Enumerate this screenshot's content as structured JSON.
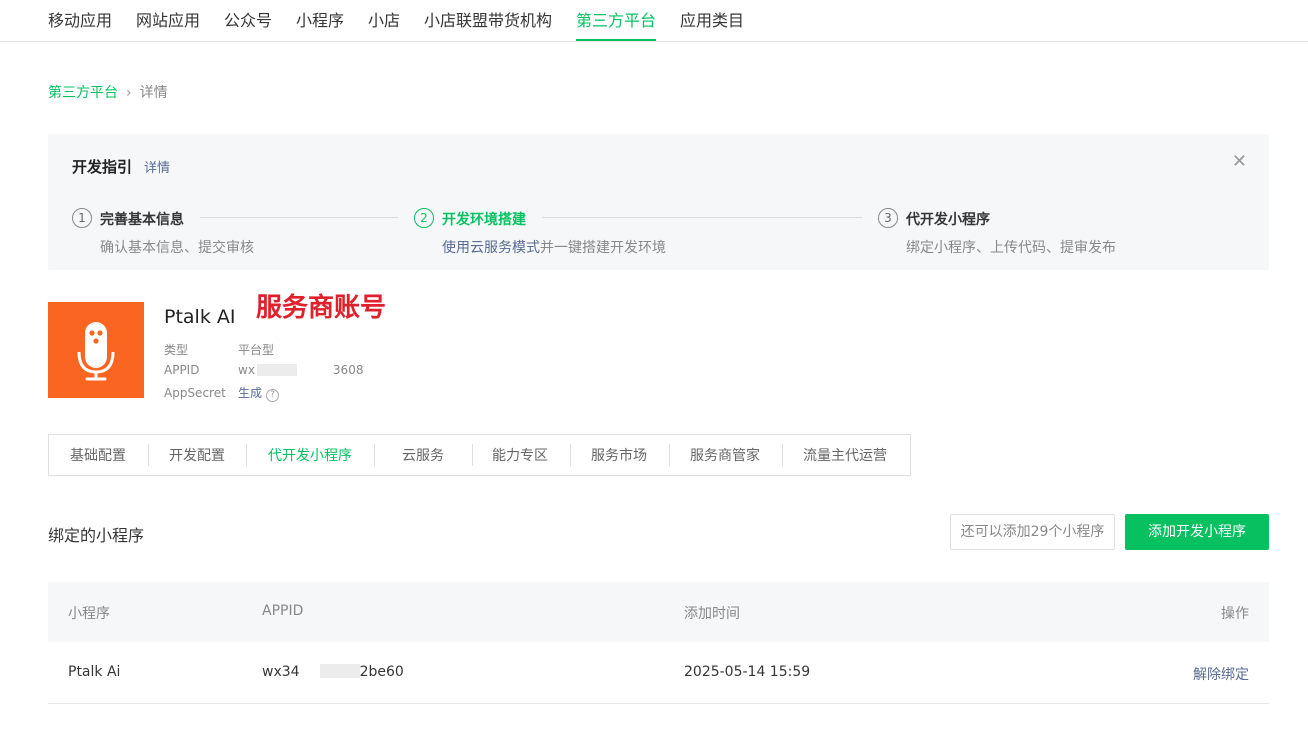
{
  "nav": {
    "items": [
      "移动应用",
      "网站应用",
      "公众号",
      "小程序",
      "小店",
      "小店联盟带货机构",
      "第三方平台",
      "应用类目"
    ],
    "active_index": 6
  },
  "breadcrumb": {
    "parent": "第三方平台",
    "separator": "›",
    "current": "详情"
  },
  "guide": {
    "title": "开发指引",
    "detail_link": "详情",
    "close": "✕",
    "steps": [
      {
        "num": "1",
        "label": "完善基本信息",
        "desc": "确认基本信息、提交审核"
      },
      {
        "num": "2",
        "label": "开发环境搭建",
        "desc_highlight": "使用云服务模式",
        "desc_rest": "并一键搭建开发环境"
      },
      {
        "num": "3",
        "label": "代开发小程序",
        "desc": "绑定小程序、上传代码、提审发布"
      }
    ]
  },
  "account": {
    "name": "Ptalk AI",
    "annotation": "服务商账号",
    "type_label": "类型",
    "type_value": "平台型",
    "appid_label": "APPID",
    "appid_prefix": "wx",
    "appid_suffix": "3608",
    "secret_label": "AppSecret",
    "secret_action": "生成",
    "help": "?"
  },
  "tabs": {
    "items": [
      "基础配置",
      "开发配置",
      "代开发小程序",
      "云服务",
      "能力专区",
      "服务市场",
      "服务商管家",
      "流量主代运营"
    ],
    "active_index": 2
  },
  "bound": {
    "title": "绑定的小程序",
    "quota_text": "还可以添加29个小程序",
    "add_button": "添加开发小程序",
    "columns": [
      "小程序",
      "APPID",
      "添加时间",
      "操作"
    ],
    "rows": [
      {
        "name": "Ptalk Ai",
        "appid_prefix": "wx34",
        "appid_suffix": "2be60",
        "time": "2025-05-14 15:59",
        "action": "解除绑定"
      }
    ]
  },
  "colors": {
    "accent": "#07c160",
    "link": "#576b95",
    "logo_bg": "#fa6621",
    "annotation": "#e0202c"
  },
  "icons": {
    "logo": "microphone-icon",
    "close": "close-icon",
    "help": "question-circle-icon"
  }
}
